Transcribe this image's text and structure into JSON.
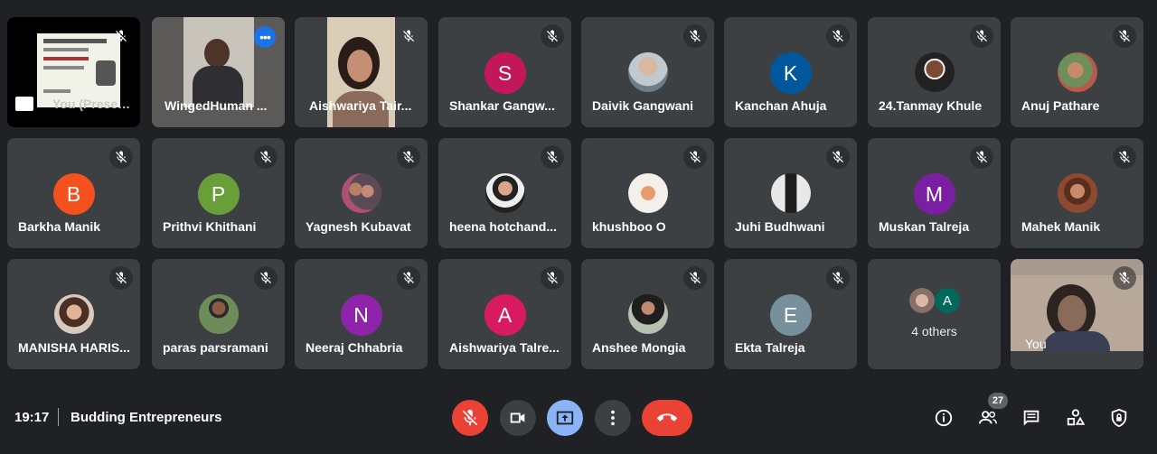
{
  "meeting": {
    "time": "19:17",
    "title": "Budding Entrepreneurs"
  },
  "participants_badge": "27",
  "tiles": {
    "presenting": {
      "name": "You (Presenting)"
    },
    "winged": {
      "name": "WingedHuman ..."
    },
    "aishwariya1": {
      "name": "Aishwariya Tair..."
    },
    "shankar": {
      "name": "Shankar Gangw...",
      "initial": "S",
      "color": "#c2185b"
    },
    "daivik": {
      "name": "Daivik Gangwani"
    },
    "kanchan": {
      "name": "Kanchan Ahuja",
      "initial": "K",
      "color": "#01579b"
    },
    "tanmay": {
      "name": "24.Tanmay Khule"
    },
    "anuj": {
      "name": "Anuj Pathare"
    },
    "barkha": {
      "name": "Barkha Manik",
      "initial": "B",
      "color": "#f4511e"
    },
    "prithvi": {
      "name": "Prithvi Khithani",
      "initial": "P",
      "color": "#689f38"
    },
    "yagnesh": {
      "name": "Yagnesh Kubavat"
    },
    "heena": {
      "name": "heena hotchand..."
    },
    "khushboo": {
      "name": "khushboo O"
    },
    "juhi": {
      "name": "Juhi Budhwani"
    },
    "muskan": {
      "name": "Muskan Talreja",
      "initial": "M",
      "color": "#7b1fa2"
    },
    "mahek": {
      "name": "Mahek Manik"
    },
    "manisha": {
      "name": "MANISHA HARIS..."
    },
    "paras": {
      "name": "paras parsramani"
    },
    "neeraj": {
      "name": "Neeraj Chhabria",
      "initial": "N",
      "color": "#8e24aa"
    },
    "aishwariya2": {
      "name": "Aishwariya Talre...",
      "initial": "A",
      "color": "#d81b60"
    },
    "anshee": {
      "name": "Anshee Mongia"
    },
    "ekta": {
      "name": "Ekta Talreja",
      "initial": "E",
      "color": "#78909c"
    },
    "others": {
      "name": "4 others",
      "initial": "A",
      "color": "#00695c"
    },
    "you": {
      "name": "You"
    }
  },
  "colors": {
    "tile_bg": "#3c4043",
    "end_call": "#ea4335",
    "mic_off_btn": "#ea4335",
    "present_btn": "#8ab4f8",
    "active_border": "#8ab4f8"
  },
  "icons": [
    "mic-off-icon",
    "camera-icon",
    "present-icon",
    "more-vert-icon",
    "end-call-icon",
    "info-icon",
    "people-icon",
    "chat-icon",
    "activities-icon",
    "host-controls-icon"
  ]
}
